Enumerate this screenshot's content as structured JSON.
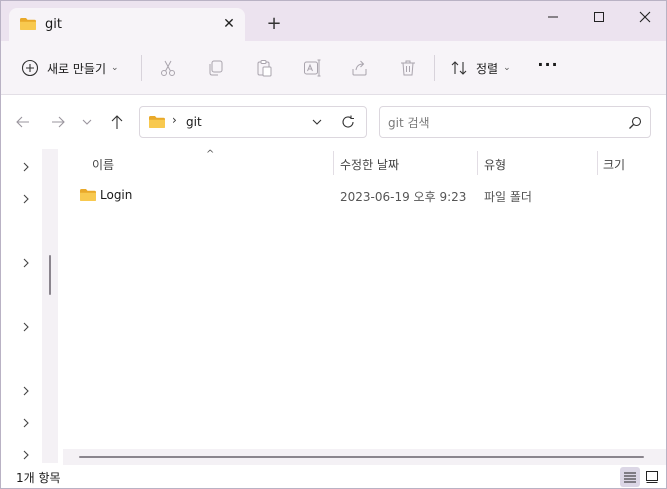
{
  "window": {
    "tab_title": "git",
    "tab_close": "✕",
    "new_tab": "+"
  },
  "toolbar": {
    "new_label": "새로 만들기",
    "new_chevron": "⌄",
    "sort_label": "정렬",
    "sort_chevron": "⌄",
    "more_label": "···",
    "icons": [
      "cut-icon",
      "copy-icon",
      "paste-icon",
      "rename-icon",
      "share-icon",
      "delete-icon"
    ]
  },
  "address": {
    "separator": "›",
    "path": "git"
  },
  "search": {
    "placeholder": "git 검색"
  },
  "columns": {
    "name": "이름",
    "date": "수정한 날짜",
    "type": "유형",
    "size": "크기",
    "sort_caret": "^"
  },
  "rows": [
    {
      "name": "Login",
      "date": "2023-06-19 오후 9:23",
      "type": "파일 폴더"
    }
  ],
  "status": {
    "item_count": "1개 항목"
  },
  "colors": {
    "titlebar": "#ece3ef",
    "commandbar": "#f7f4f8",
    "folder": "#f5c04a",
    "accent": "#dcd7e6"
  }
}
